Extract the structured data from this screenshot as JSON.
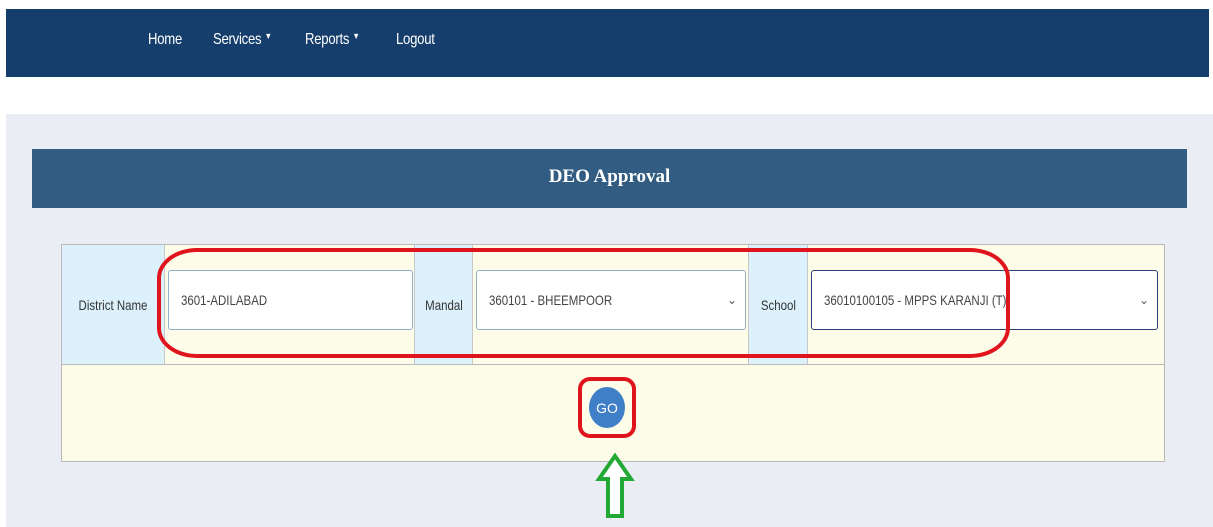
{
  "nav": {
    "items": [
      {
        "label": "Home",
        "has_caret": false
      },
      {
        "label": "Services",
        "has_caret": true,
        "caret": "▼"
      },
      {
        "label": "Reports",
        "has_caret": true,
        "caret": "▼"
      },
      {
        "label": "Logout",
        "has_caret": false
      }
    ]
  },
  "panel": {
    "title": "DEO Approval"
  },
  "form": {
    "district_label": "District Name",
    "district_value": "3601-ADILABAD",
    "mandal_label": "Mandal",
    "mandal_value": "360101 - BHEEMPOOR",
    "school_label": "School",
    "school_value": "36010100105 - MPPS KARANJI (T)",
    "dropdown_chevron": "⌄",
    "go_label": "GO"
  },
  "annotations": {
    "highlight_color": "#e0141c",
    "arrow_color": "#22a834"
  },
  "colors": {
    "navbar": "#163e6c",
    "panel_header": "#335c82",
    "label_cell": "#dcf1fb",
    "form_background": "#fdfce8",
    "go_button": "#3f7fc8"
  }
}
